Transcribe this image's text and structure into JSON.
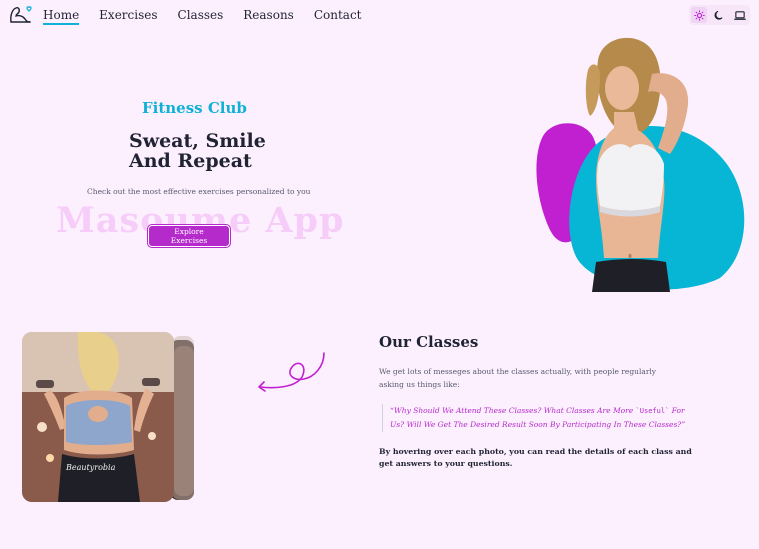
{
  "nav": {
    "links": [
      {
        "label": "Home",
        "active": true
      },
      {
        "label": "Exercises"
      },
      {
        "label": "Classes"
      },
      {
        "label": "Reasons"
      },
      {
        "label": "Contact"
      }
    ],
    "theme_buttons": [
      "sun-icon",
      "moon-icon",
      "laptop-icon"
    ],
    "active_theme": "sun-icon"
  },
  "hero": {
    "subtitle": "Fitness Club",
    "title_line1": "Sweat, Smile",
    "title_line2": "And Repeat",
    "description": "Check out the most effective exercises personalized to you",
    "watermark": "Masoume App",
    "button": "Explore Exercises"
  },
  "classes": {
    "title": "Our Classes",
    "text": "We get lots of messeges about the classes actually, with people regularly asking us things like:",
    "quote_before": "“Why Should We Attend These Classes? What Classes Are More ",
    "quote_code": "`Useful`",
    "quote_after": " For Us? Will We Get The Desired Result Soon By Participating In These Classes?”",
    "note": "By hovering over each photo, you can read the details of each class and get answers to your questions.",
    "photo_text": "Beautyrobia"
  },
  "colors": {
    "background": "#fdf0fe",
    "accent_purple": "#b42acb",
    "accent_cyan": "#0fb1d6",
    "text_dark": "#1f2333"
  }
}
